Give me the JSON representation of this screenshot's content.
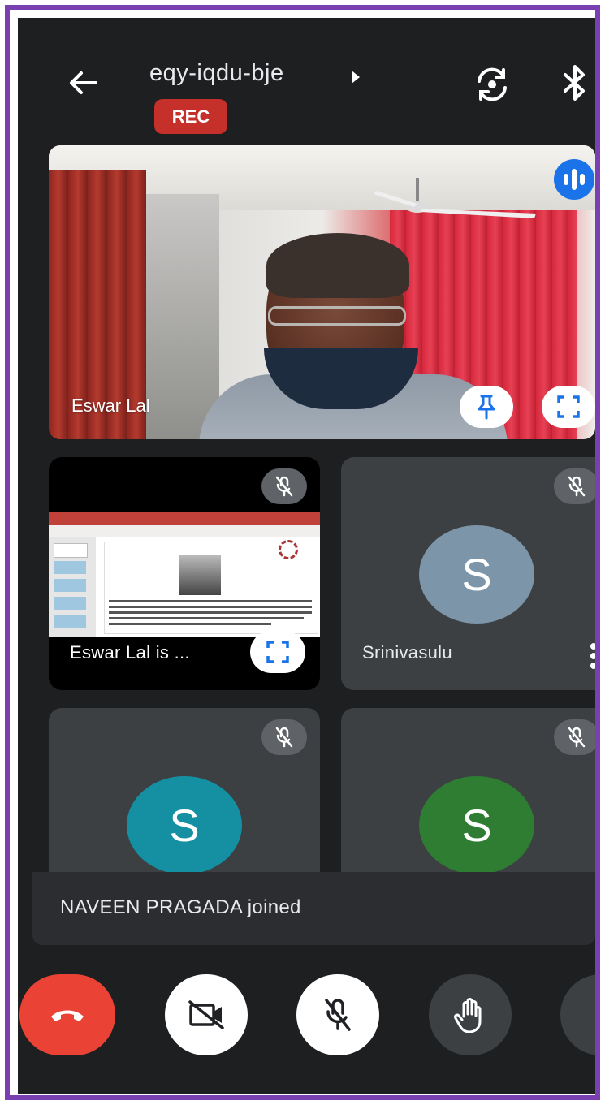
{
  "header": {
    "meeting_code": "eqy-iqdu-bje",
    "rec_label": "REC"
  },
  "main_video": {
    "participant_name": "Eswar Lal"
  },
  "tiles": [
    {
      "name": "Eswar Lal is ...",
      "type": "presentation",
      "muted": true
    },
    {
      "name": "Srinivasulu",
      "avatar_letter": "S",
      "avatar_color": "#7d95a8",
      "muted": true
    },
    {
      "name": "",
      "avatar_letter": "S",
      "avatar_color": "#1590a3",
      "muted": true
    },
    {
      "name": "",
      "avatar_letter": "S",
      "avatar_color": "#2e7d32",
      "muted": true
    }
  ],
  "toast": {
    "message": "NAVEEN PRAGADA joined"
  },
  "colors": {
    "end_call": "#ea4335",
    "rec": "#c5302b",
    "speaking_badge": "#1a73e8"
  },
  "icons": [
    "back-arrow-icon",
    "play-caret-icon",
    "switch-camera-icon",
    "bluetooth-icon",
    "speaking-icon",
    "pin-icon",
    "fullscreen-icon",
    "mic-off-icon",
    "more-vert-icon",
    "end-call-icon",
    "camera-off-icon",
    "raise-hand-icon"
  ]
}
